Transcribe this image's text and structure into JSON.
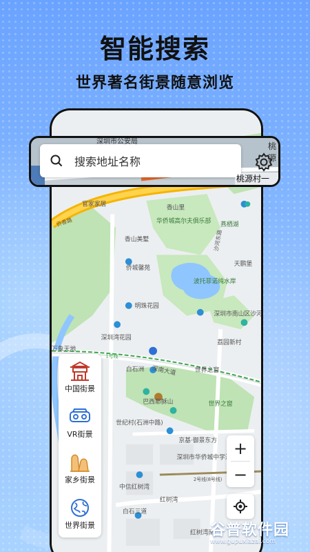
{
  "promo": {
    "headline": "智能搜索",
    "subline": "世界著名街景随意浏览"
  },
  "search": {
    "placeholder": "搜索地址名称",
    "label_top": "桃源",
    "label_bottom": "桃源村一期"
  },
  "map_labels": {
    "police": "深圳市公安局",
    "guanjia": "官家家居",
    "xiangshanli": "香山里",
    "huaqiao": "华侨城高尔夫俱乐部",
    "xiangshanmeishu": "香山美墅",
    "qiaochengxinyuan": "侨城馨苑",
    "tianpengbao": "天鹏堡",
    "yanchui": "燕栖湖",
    "lake": "波托菲诺纯水岸",
    "mingzhu": "明珠花园",
    "nanshan": "深圳市南山区沙河小学",
    "shenwan": "深圳湾花园",
    "jiyuan": "荔园新村",
    "wanxiang": "万象天地",
    "shennan": "深南大道",
    "baishizhou": "白石洲",
    "window": "世界之窗",
    "barcelona": "巴西耶稣山",
    "window2": "世界之窗",
    "shijicun": "世纪村(石洲中路)",
    "jingji": "京基·御景东方",
    "middleschool": "深圳市华侨城中学深圳湾部",
    "zhongxin": "中信红树湾",
    "baishisandao": "白石三道",
    "hongshuwan": "红树湾",
    "hongshuwan_south": "红树湾南",
    "line9": "2号线(8号线)",
    "road_label": "侨香路",
    "road_shahe": "沙河东路",
    "line1": "1号线"
  },
  "categories": [
    {
      "label": "中国街景",
      "icon": "gate-icon"
    },
    {
      "label": "VR街景",
      "icon": "vr-glasses-icon"
    },
    {
      "label": "家乡街景",
      "icon": "hometown-icon"
    },
    {
      "label": "世界街景",
      "icon": "globe-icon"
    }
  ],
  "controls": {
    "zoom_in": "+",
    "zoom_out": "−"
  },
  "watermark": {
    "main": "谷普软件园",
    "url": "www.gupuxiazai.com"
  },
  "colors": {
    "background": "#7fb2ff",
    "category_red": "#c0392b",
    "category_blue": "#2f6fd6",
    "category_orange": "#e0a040",
    "highway": "#f5b400",
    "park": "#bfe3b4",
    "water": "#8fc6ff"
  }
}
